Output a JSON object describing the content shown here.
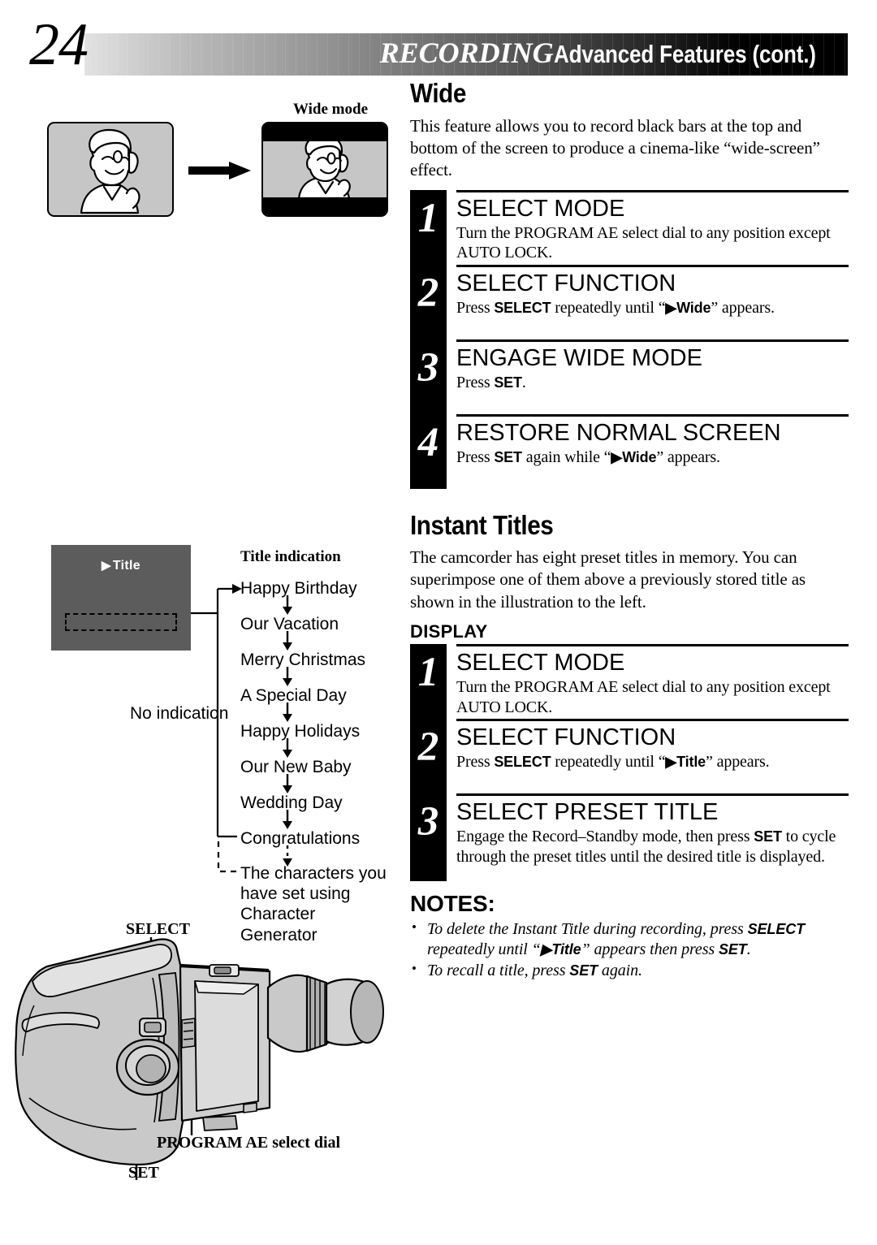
{
  "header": {
    "page_number": "24",
    "title_italic": "RECORDING",
    "title_rest": "Advanced Features (cont.)"
  },
  "wide_illustration": {
    "wide_mode_label": "Wide mode",
    "arrow_icon": "right-arrow-icon"
  },
  "wide_section": {
    "heading": "Wide",
    "intro": "This feature allows you to record black bars at the top and bottom of the screen to produce a cinema-like “wide-screen” effect.",
    "steps": [
      {
        "number": "1",
        "title": "SELECT MODE",
        "body_pre": "Turn the PROGRAM AE select dial to any position except AUTO LOCK.",
        "body_parts": []
      },
      {
        "number": "2",
        "title": "SELECT FUNCTION",
        "body_pre": "Press ",
        "body_bold1": "SELECT",
        "body_mid": " repeatedly until “",
        "body_bold2": "▶Wide",
        "body_post": "” appears."
      },
      {
        "number": "3",
        "title": "ENGAGE WIDE MODE",
        "body_pre": "Press ",
        "body_bold1": "SET",
        "body_post": "."
      },
      {
        "number": "4",
        "title": "RESTORE NORMAL SCREEN",
        "body_pre": "Press ",
        "body_bold1": "SET",
        "body_mid": " again while “",
        "body_bold2": "▶Wide",
        "body_post": "” appears."
      }
    ]
  },
  "title_flow": {
    "screen_osd_label": "Title",
    "screen_osd_icon": "play-triangle-icon",
    "flow_heading": "Title indication",
    "no_indication_label": "No indication",
    "items": [
      "Happy Birthday",
      "Our Vacation",
      "Merry Christmas",
      "A Special Day",
      "Happy Holidays",
      "Our New Baby",
      "Wedding Day",
      "Congratulations"
    ],
    "custom_item": "The characters you have set using Character Generator"
  },
  "instant_titles_section": {
    "heading": "Instant Titles",
    "intro": "The camcorder has eight preset titles in memory. You can superimpose one of them above a previously stored title as shown in the illustration to the left.",
    "display_label": "DISPLAY",
    "steps": [
      {
        "number": "1",
        "title": "SELECT MODE",
        "body_pre": "Turn the PROGRAM AE select dial to any position except AUTO LOCK."
      },
      {
        "number": "2",
        "title": "SELECT FUNCTION",
        "body_pre": "Press ",
        "body_bold1": "SELECT",
        "body_mid": " repeatedly until “",
        "body_bold2": "▶Title",
        "body_post": "” appears."
      },
      {
        "number": "3",
        "title": "SELECT PRESET TITLE",
        "body_pre": "Engage the Record–Standby mode, then press ",
        "body_bold1": "SET",
        "body_post": " to cycle through the preset titles until the desired title is displayed."
      }
    ]
  },
  "notes": {
    "heading": "NOTES:",
    "items": [
      {
        "pre": "To delete the Instant Title during recording, press ",
        "bold1": "SELECT",
        "mid": " repeatedly until “",
        "bold2": "▶Title",
        "mid2": "” appears then press ",
        "bold3": "SET",
        "post": "."
      },
      {
        "pre": "To recall a title, press ",
        "bold1": "SET",
        "post": " again."
      }
    ]
  },
  "camcorder": {
    "label_select": "SELECT",
    "label_set": "SET",
    "label_dial": "PROGRAM AE select dial"
  },
  "colors": {
    "screen_gray": "#5c5c5c",
    "illus_gray": "#c6c6c6",
    "black": "#000000",
    "white": "#ffffff"
  }
}
